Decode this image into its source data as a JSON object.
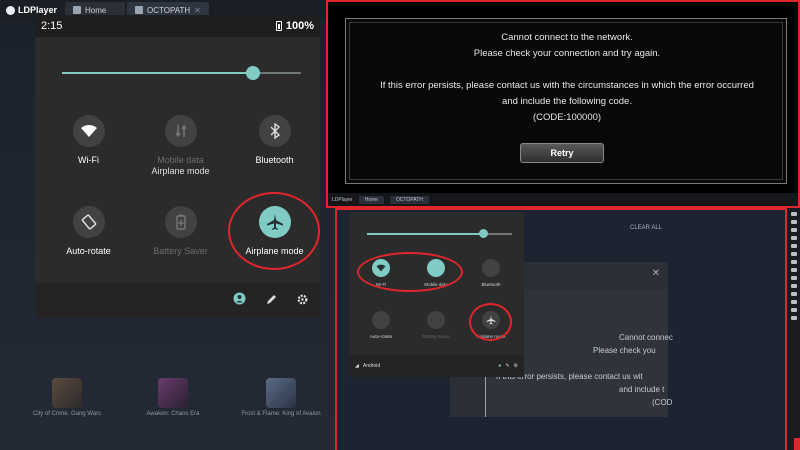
{
  "app": {
    "name": "LDPlayer"
  },
  "tabs": [
    {
      "label": "Home"
    },
    {
      "label": "OCTOPATH"
    }
  ],
  "quick_settings": {
    "time": "2:15",
    "battery": "100%",
    "brightness_level": 0.8,
    "tiles": [
      {
        "label": "Wi-Fi",
        "icon": "wifi-icon",
        "state": "off"
      },
      {
        "label": "Mobile data",
        "sublabel": "Airplane mode",
        "icon": "mobile-data-icon",
        "state": "disabled"
      },
      {
        "label": "Bluetooth",
        "icon": "bluetooth-icon",
        "state": "off"
      },
      {
        "label": "Auto-rotate",
        "icon": "auto-rotate-icon",
        "state": "off"
      },
      {
        "label": "Battery Saver",
        "icon": "battery-saver-icon",
        "state": "disabled"
      },
      {
        "label": "Airplane mode",
        "icon": "airplane-icon",
        "state": "on"
      }
    ]
  },
  "home_apps": [
    {
      "label": "City of Crime: Gang Wars"
    },
    {
      "label": "Awaken: Chaos Era"
    },
    {
      "label": "Frost & Flame: King of Avalon"
    }
  ],
  "error_dialog": {
    "line1": "Cannot connect to the network.",
    "line2": "Please check your connection and try again.",
    "line3": "If this error persists, please contact us with the circumstances in which the error occurred",
    "line4": "and include the following code.",
    "code": "(CODE:100000)",
    "retry_label": "Retry"
  },
  "bottom_panel": {
    "clear_all": "CLEAR ALL",
    "footer_label": "Android",
    "dialog_lines": [
      "Cannot connec",
      "Please check you",
      "If this error persists, please contact us wit",
      "and include t",
      "(COD"
    ]
  },
  "colors": {
    "accent": "#80cbc4",
    "highlight": "#e0262c"
  }
}
